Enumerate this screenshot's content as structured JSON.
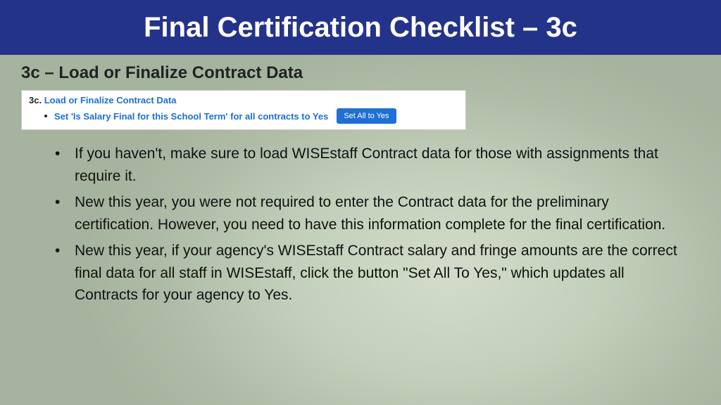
{
  "title": "Final Certification Checklist – 3c",
  "subtitle": "3c – Load or Finalize Contract Data",
  "snippet": {
    "step": "3c.",
    "link": "Load or Finalize Contract Data",
    "action_text": "Set 'Is Salary Final for this School Term' for all contracts to Yes",
    "button_label": "Set All to Yes"
  },
  "bullets": [
    "If you haven't, make sure to load WISEstaff Contract data for those with assignments that require it.",
    "New this year, you were not required to enter the Contract data for the preliminary certification. However, you need to have this information complete for the final certification.",
    "New this year,  if your agency's WISEstaff Contract salary and fringe amounts are the correct final data for all staff in WISEstaff, click the button \"Set All To Yes,\" which updates all Contracts for your agency to Yes."
  ]
}
